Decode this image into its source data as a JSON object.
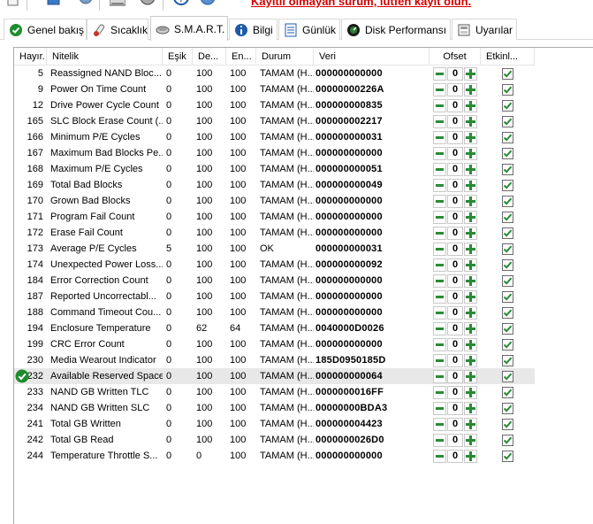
{
  "banner": "Kayıtlı olmayan sürüm, lütfen kayıt olun.",
  "tabs": [
    {
      "label": "Genel bakış",
      "icon": "check-circle-icon",
      "active": false
    },
    {
      "label": "Sıcaklık",
      "icon": "thermometer-icon",
      "active": false
    },
    {
      "label": "S.M.A.R.T.",
      "icon": "drive-icon",
      "active": true
    },
    {
      "label": "Bilgi",
      "icon": "info-icon",
      "active": false
    },
    {
      "label": "Günlük",
      "icon": "log-icon",
      "active": false
    },
    {
      "label": "Disk Performansı",
      "icon": "gauge-icon",
      "active": false
    },
    {
      "label": "Uyarılar",
      "icon": "alerts-icon",
      "active": false
    }
  ],
  "columns": {
    "id": "Hayır.",
    "name": "Nitelik",
    "threshold": "Eşik",
    "current": "De...",
    "worst": "En...",
    "status": "Durum",
    "data": "Veri",
    "offset": "Ofset",
    "enabled": "Etkinl..."
  },
  "rows": [
    {
      "id": "5",
      "name": "Reassigned NAND Bloc...",
      "threshold": "0",
      "current": "100",
      "worst": "100",
      "status": "TAMAM (H...",
      "data": "000000000000",
      "offset": "0",
      "enabled": true
    },
    {
      "id": "9",
      "name": "Power On Time Count",
      "threshold": "0",
      "current": "100",
      "worst": "100",
      "status": "TAMAM (H...",
      "data": "00000000226A",
      "offset": "0",
      "enabled": true
    },
    {
      "id": "12",
      "name": "Drive Power Cycle Count",
      "threshold": "0",
      "current": "100",
      "worst": "100",
      "status": "TAMAM (H...",
      "data": "000000000835",
      "offset": "0",
      "enabled": true
    },
    {
      "id": "165",
      "name": "SLC Block Erase Count (...",
      "threshold": "0",
      "current": "100",
      "worst": "100",
      "status": "TAMAM (H...",
      "data": "000000002217",
      "offset": "0",
      "enabled": true
    },
    {
      "id": "166",
      "name": "Minimum P/E Cycles",
      "threshold": "0",
      "current": "100",
      "worst": "100",
      "status": "TAMAM (H...",
      "data": "000000000031",
      "offset": "0",
      "enabled": true
    },
    {
      "id": "167",
      "name": "Maximum Bad Blocks Pe...",
      "threshold": "0",
      "current": "100",
      "worst": "100",
      "status": "TAMAM (H...",
      "data": "000000000000",
      "offset": "0",
      "enabled": true
    },
    {
      "id": "168",
      "name": "Maximum P/E Cycles",
      "threshold": "0",
      "current": "100",
      "worst": "100",
      "status": "TAMAM (H...",
      "data": "000000000051",
      "offset": "0",
      "enabled": true
    },
    {
      "id": "169",
      "name": "Total Bad Blocks",
      "threshold": "0",
      "current": "100",
      "worst": "100",
      "status": "TAMAM (H...",
      "data": "000000000049",
      "offset": "0",
      "enabled": true
    },
    {
      "id": "170",
      "name": "Grown Bad Blocks",
      "threshold": "0",
      "current": "100",
      "worst": "100",
      "status": "TAMAM (H...",
      "data": "000000000000",
      "offset": "0",
      "enabled": true
    },
    {
      "id": "171",
      "name": "Program Fail Count",
      "threshold": "0",
      "current": "100",
      "worst": "100",
      "status": "TAMAM (H...",
      "data": "000000000000",
      "offset": "0",
      "enabled": true
    },
    {
      "id": "172",
      "name": "Erase Fail Count",
      "threshold": "0",
      "current": "100",
      "worst": "100",
      "status": "TAMAM (H...",
      "data": "000000000000",
      "offset": "0",
      "enabled": true
    },
    {
      "id": "173",
      "name": "Average P/E Cycles",
      "threshold": "5",
      "current": "100",
      "worst": "100",
      "status": "OK",
      "data": "000000000031",
      "offset": "0",
      "enabled": true
    },
    {
      "id": "174",
      "name": "Unexpected Power Loss...",
      "threshold": "0",
      "current": "100",
      "worst": "100",
      "status": "TAMAM (H...",
      "data": "000000000092",
      "offset": "0",
      "enabled": true
    },
    {
      "id": "184",
      "name": "Error Correction Count",
      "threshold": "0",
      "current": "100",
      "worst": "100",
      "status": "TAMAM (H...",
      "data": "000000000000",
      "offset": "0",
      "enabled": true
    },
    {
      "id": "187",
      "name": "Reported Uncorrectabl...",
      "threshold": "0",
      "current": "100",
      "worst": "100",
      "status": "TAMAM (H...",
      "data": "000000000000",
      "offset": "0",
      "enabled": true
    },
    {
      "id": "188",
      "name": "Command Timeout Cou...",
      "threshold": "0",
      "current": "100",
      "worst": "100",
      "status": "TAMAM (H...",
      "data": "000000000000",
      "offset": "0",
      "enabled": true
    },
    {
      "id": "194",
      "name": "Enclosure Temperature",
      "threshold": "0",
      "current": "62",
      "worst": "64",
      "status": "TAMAM (H...",
      "data": "0040000D0026",
      "offset": "0",
      "enabled": true
    },
    {
      "id": "199",
      "name": "CRC Error Count",
      "threshold": "0",
      "current": "100",
      "worst": "100",
      "status": "TAMAM (H...",
      "data": "000000000000",
      "offset": "0",
      "enabled": true
    },
    {
      "id": "230",
      "name": "Media Wearout Indicator",
      "threshold": "0",
      "current": "100",
      "worst": "100",
      "status": "TAMAM (H...",
      "data": "185D0950185D",
      "offset": "0",
      "enabled": true
    },
    {
      "id": "232",
      "name": "Available Reserved Space",
      "threshold": "0",
      "current": "100",
      "worst": "100",
      "status": "TAMAM (H...",
      "data": "000000000064",
      "offset": "0",
      "enabled": true,
      "selected": true,
      "ok_icon": "green-check-icon"
    },
    {
      "id": "233",
      "name": "NAND GB Written TLC",
      "threshold": "0",
      "current": "100",
      "worst": "100",
      "status": "TAMAM (H...",
      "data": "0000000016FF",
      "offset": "0",
      "enabled": true
    },
    {
      "id": "234",
      "name": "NAND GB Written SLC",
      "threshold": "0",
      "current": "100",
      "worst": "100",
      "status": "TAMAM (H...",
      "data": "00000000BDA3",
      "offset": "0",
      "enabled": true
    },
    {
      "id": "241",
      "name": "Total GB Written",
      "threshold": "0",
      "current": "100",
      "worst": "100",
      "status": "TAMAM (H...",
      "data": "000000004423",
      "offset": "0",
      "enabled": true
    },
    {
      "id": "242",
      "name": "Total GB Read",
      "threshold": "0",
      "current": "100",
      "worst": "100",
      "status": "TAMAM (H...",
      "data": "0000000026D0",
      "offset": "0",
      "enabled": true
    },
    {
      "id": "244",
      "name": "Temperature Throttle S...",
      "threshold": "0",
      "current": "0",
      "worst": "100",
      "status": "TAMAM (H...",
      "data": "000000000000",
      "offset": "0",
      "enabled": true
    }
  ],
  "colors": {
    "banner": "#d40000",
    "accent_green": "#2a8a36",
    "selected_row": "#e8e8e8"
  }
}
